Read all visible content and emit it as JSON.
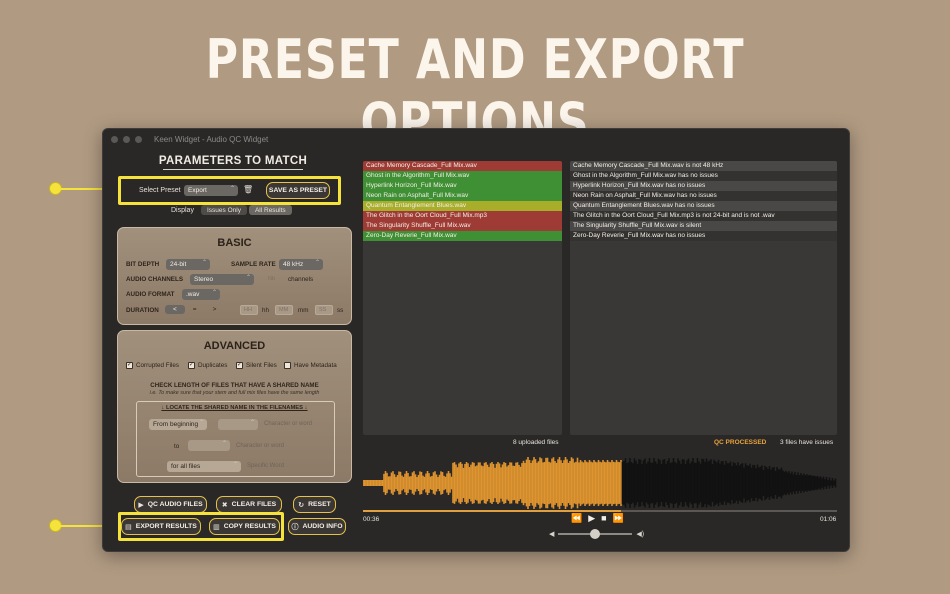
{
  "headline": "PRESET AND EXPORT OPTIONS",
  "window": {
    "title": "Keen Widget - Audio QC Widget"
  },
  "parameters": {
    "title": "PARAMETERS TO MATCH",
    "select_preset_label": "Select Preset",
    "preset_value": "Export",
    "save_as_preset": "SAVE AS PRESET",
    "display_label": "Display",
    "display_options": [
      "Issues Only",
      "All Results"
    ],
    "display_selected": "All Results"
  },
  "basic": {
    "title": "BASIC",
    "bit_depth_label": "BIT DEPTH",
    "bit_depth_value": "24-bit",
    "sample_rate_label": "SAMPLE RATE",
    "sample_rate_value": "48 kHz",
    "audio_channels_label": "AUDIO CHANNELS",
    "audio_channels_value": "Stereo",
    "channels_count_placeholder": "Nb",
    "channels_suffix": "channels",
    "audio_format_label": "AUDIO FORMAT",
    "audio_format_value": ".wav",
    "duration_label": "DURATION",
    "duration_ops": [
      "<",
      "=",
      ">"
    ],
    "hh_placeholder": "HH",
    "hh_label": "hh",
    "mm_placeholder": "MM",
    "mm_label": "mm",
    "ss_placeholder": "SS",
    "ss_label": "ss"
  },
  "advanced": {
    "title": "ADVANCED",
    "checks": [
      {
        "label": "Corrupted Files",
        "checked": true
      },
      {
        "label": "Duplicates",
        "checked": true
      },
      {
        "label": "Silent Files",
        "checked": true
      },
      {
        "label": "Have Metadata",
        "checked": false
      }
    ],
    "shared_name_title": "CHECK LENGTH OF FILES THAT HAVE A SHARED NAME",
    "shared_name_hint": "i.e. To make sure that your stem and full mix files have the same length",
    "locate_title": "↓ LOCATE THE SHARED NAME IN THE FILENAMES ↓",
    "from_value": "From beginning",
    "char_or_word_1": "Character or word",
    "to_label": "to",
    "char_or_word_2": "Character or word",
    "for_all_value": "for all files",
    "specific_word": "Specific Word"
  },
  "buttons": {
    "qc_audio_files": "QC AUDIO FILES",
    "clear_files": "CLEAR FILES",
    "reset": "RESET",
    "export_results": "EXPORT RESULTS",
    "copy_results": "COPY RESULTS",
    "audio_info": "AUDIO INFO"
  },
  "files": [
    {
      "name": "Cache Memory Cascade_Full Mix.wav",
      "status": "red"
    },
    {
      "name": "Ghost in the Algorithm_Full Mix.wav",
      "status": "green"
    },
    {
      "name": "Hyperlink Horizon_Full Mix.wav",
      "status": "green"
    },
    {
      "name": "Neon Rain on Asphalt_Full Mix.wav",
      "status": "green"
    },
    {
      "name": "Quantum Entanglement Blues.wav",
      "status": "yellow"
    },
    {
      "name": "The Glitch in the Oort Cloud_Full Mix.mp3",
      "status": "red"
    },
    {
      "name": "The Singularity Shuffle_Full Mix.wav",
      "status": "red"
    },
    {
      "name": "Zero-Day Reverie_Full Mix.wav",
      "status": "green"
    }
  ],
  "results": [
    "Cache Memory Cascade_Full Mix.wav is not 48 kHz",
    "Ghost in the Algorithm_Full Mix.wav has no issues",
    "Hyperlink Horizon_Full Mix.wav has no issues",
    "Neon Rain on Asphalt_Full Mix.wav has no issues",
    "Quantum Entanglement Blues.wav has no issues",
    "The Glitch in the Oort Cloud_Full Mix.mp3 is not 24-bit and is not .wav",
    "The Singularity Shuffle_Full Mix.wav is silent",
    "Zero-Day Reverie_Full Mix.wav has no issues"
  ],
  "status": {
    "uploaded": "8 uploaded files",
    "qc_processed": "QC PROCESSED",
    "issues": "3 files have issues"
  },
  "player": {
    "current_time": "00:36",
    "total_time": "01:06",
    "progress": 0.545,
    "volume": 0.5
  },
  "colors": {
    "accent": "#e7c24a",
    "callout": "#f5e23a",
    "waveform_played": "#e09430",
    "waveform_unplayed": "#111111",
    "qc_processed": "#e9a23a"
  }
}
